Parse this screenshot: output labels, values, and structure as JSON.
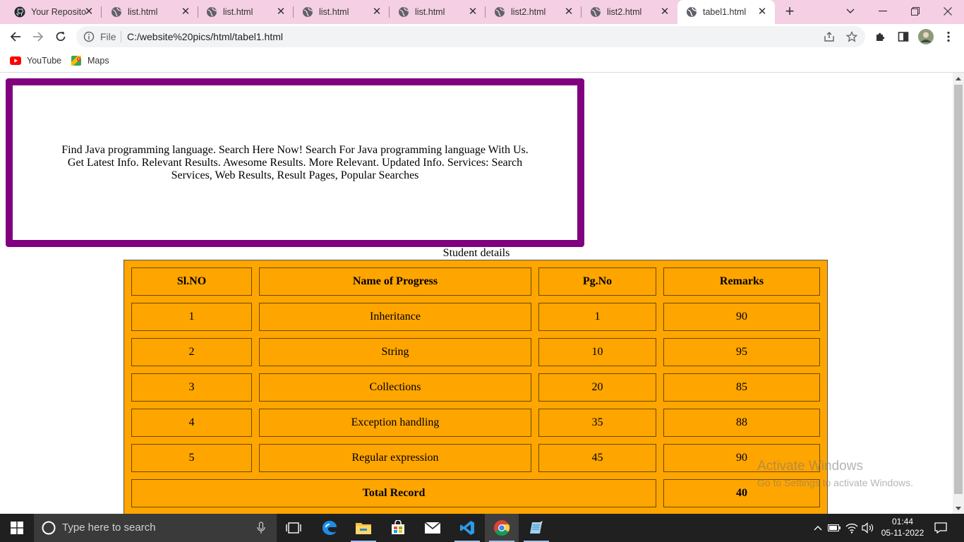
{
  "browser": {
    "tabs": [
      {
        "label": "Your Repositor",
        "icon": "github-icon",
        "active": false
      },
      {
        "label": "list.html",
        "icon": "globe-icon",
        "active": false
      },
      {
        "label": "list.html",
        "icon": "globe-icon",
        "active": false
      },
      {
        "label": "list.html",
        "icon": "globe-icon",
        "active": false
      },
      {
        "label": "list.html",
        "icon": "globe-icon",
        "active": false
      },
      {
        "label": "list2.html",
        "icon": "globe-icon",
        "active": false
      },
      {
        "label": "list2.html",
        "icon": "globe-icon",
        "active": false
      },
      {
        "label": "tabel1.html",
        "icon": "globe-icon",
        "active": true
      }
    ],
    "omnibox": {
      "scheme_label": "File",
      "url": "C:/website%20pics/html/tabel1.html"
    },
    "bookmarks": [
      {
        "label": "YouTube",
        "icon": "youtube-icon"
      },
      {
        "label": "Maps",
        "icon": "maps-icon"
      }
    ]
  },
  "page": {
    "ad_text": "Find Java programming language. Search Here Now! Search For Java programming language With Us. Get Latest Info. Relevant Results. Awesome Results. More Relevant. Updated Info. Services: Search Services, Web Results, Result Pages, Popular Searches",
    "table": {
      "caption": "Student details",
      "headers": [
        "Sl.NO",
        "Name of Progress",
        "Pg.No",
        "Remarks"
      ],
      "rows": [
        [
          "1",
          "Inheritance",
          "1",
          "90"
        ],
        [
          "2",
          "String",
          "10",
          "95"
        ],
        [
          "3",
          "Collections",
          "20",
          "85"
        ],
        [
          "4",
          "Exception handling",
          "35",
          "88"
        ],
        [
          "5",
          "Regular expression",
          "45",
          "90"
        ]
      ],
      "total_label": "Total Record",
      "total_value": "40",
      "background_color": "#ffa500"
    },
    "ad_border_color": "#800080"
  },
  "watermark": {
    "line1": "Activate Windows",
    "line2": "Go to Settings to activate Windows."
  },
  "taskbar": {
    "search_placeholder": "Type here to search",
    "apps": [
      "task-view-icon",
      "edge-icon",
      "file-explorer-icon",
      "store-icon",
      "mail-icon",
      "vscode-icon",
      "chrome-icon",
      "notepad-icon"
    ],
    "time": "01:44",
    "date": "05-11-2022"
  }
}
